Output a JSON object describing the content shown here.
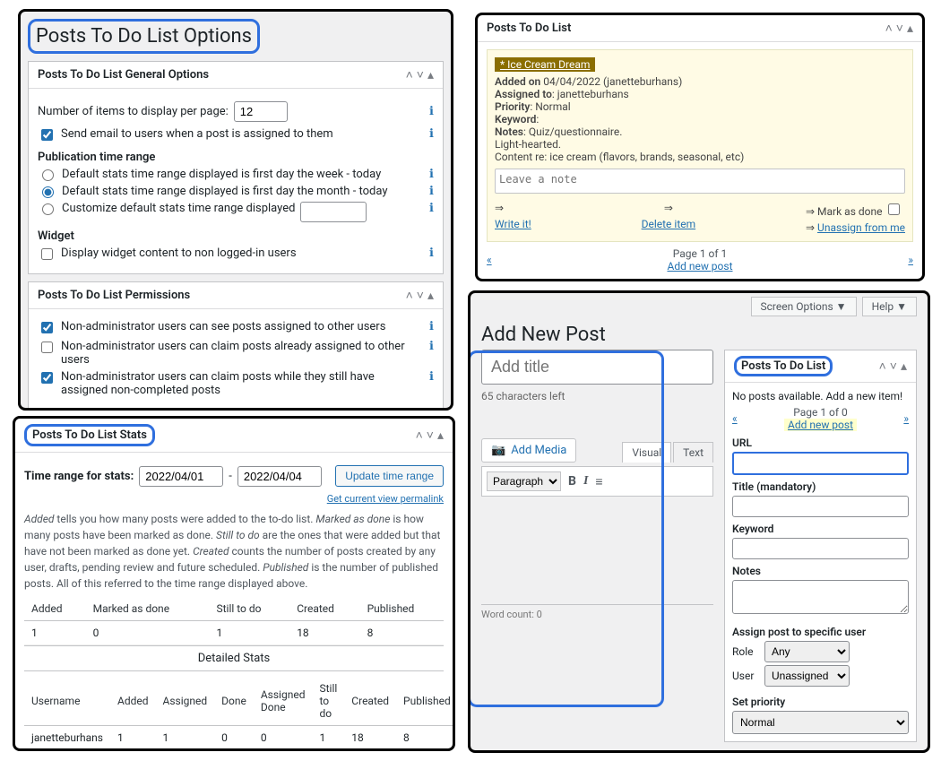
{
  "options_title": "Posts To Do List Options",
  "general": {
    "title": "Posts To Do List General Options",
    "items_label": "Number of items to display per page:",
    "items_value": "12",
    "send_email_label": "Send email to users when a post is assigned to them",
    "pub_range_head": "Publication time range",
    "radio_week": "Default stats time range displayed is first day the week - today",
    "radio_month": "Default stats time range displayed is first day the month - today",
    "radio_custom": "Customize default stats time range displayed",
    "widget_head": "Widget",
    "widget_check": "Display widget content to non logged-in users"
  },
  "perms": {
    "title": "Posts To Do List Permissions",
    "p1": "Non-administrator users can see posts assigned to other users",
    "p2": "Non-administrator users can claim posts already assigned to other users",
    "p3": "Non-administrator users can claim posts while they still have assigned non-completed posts"
  },
  "stats": {
    "title": "Posts To Do List Stats",
    "range_label": "Time range for stats:",
    "from": "2022/04/01",
    "to": "2022/04/04",
    "update_btn": "Update time range",
    "permalink": "Get current view permalink",
    "help_prefix1": "Added",
    "help_t1": " tells you how many posts were added to the to-do list. ",
    "help_prefix2": "Marked as done",
    "help_t2": " is how many posts have been marked as done. ",
    "help_prefix3": "Still to do",
    "help_t3": " are the ones that were added but that have not been marked as done yet. ",
    "help_prefix4": "Created",
    "help_t4": " counts the number of posts created by any user, drafts, pending review and future scheduled. ",
    "help_prefix5": "Published",
    "help_t5": " is the number of published posts. All of this referred to the time range displayed above.",
    "cols": [
      "Added",
      "Marked as done",
      "Still to do",
      "Created",
      "Published"
    ],
    "vals": [
      "1",
      "0",
      "1",
      "18",
      "8"
    ],
    "detailed_title": "Detailed Stats",
    "dcols": [
      "Username",
      "Added",
      "Assigned",
      "Done",
      "Assigned Done",
      "Still to do",
      "Created",
      "Published"
    ],
    "drow": [
      "janetteburhans",
      "1",
      "1",
      "0",
      "0",
      "1",
      "18",
      "8"
    ]
  },
  "todolist": {
    "title": "Posts To Do List",
    "item_title": "* Ice Cream Dream",
    "added_on_label": "Added on",
    "added_on_val": " 04/04/2022 (janetteburhans)",
    "assigned_label": "Assigned to",
    "assigned_val": ": janetteburhans",
    "priority_label": "Priority",
    "priority_val": ": Normal",
    "keyword_label": "Keyword",
    "keyword_val": ":",
    "notes_label": "Notes",
    "notes_val": ": Quiz/questionnaire.",
    "notes_line2": "Light-hearted.",
    "notes_line3": "Content re: ice cream (flavors, brands, seasonal, etc)",
    "leave_note_ph": "Leave a note",
    "write_it": "Write it!",
    "mark_done": "Mark as done",
    "unassign": "Unassign from me",
    "delete": "Delete item",
    "page_of": "Page 1 of 1",
    "add_new": "Add new post"
  },
  "newpost": {
    "screen_options": "Screen Options ▼",
    "help": "Help ▼",
    "page_title": "Add New Post",
    "title_ph": "Add title",
    "counter": "65 characters left",
    "add_media": "Add Media",
    "tab_visual": "Visual",
    "tab_text": "Text",
    "para": "Paragraph",
    "wordcount": "Word count: 0",
    "side_title": "Posts To Do List",
    "no_posts": "No posts available. Add a new item!",
    "page_of": "Page 1 of 0",
    "add_new": "Add new post",
    "url_label": "URL",
    "title_label": "Title (mandatory)",
    "keyword_label": "Keyword",
    "notes_label": "Notes",
    "assign_head": "Assign post to specific user",
    "role_label": "Role",
    "role_val": "Any",
    "user_label": "User",
    "user_val": "Unassigned",
    "priority_head": "Set priority",
    "priority_val": "Normal"
  }
}
